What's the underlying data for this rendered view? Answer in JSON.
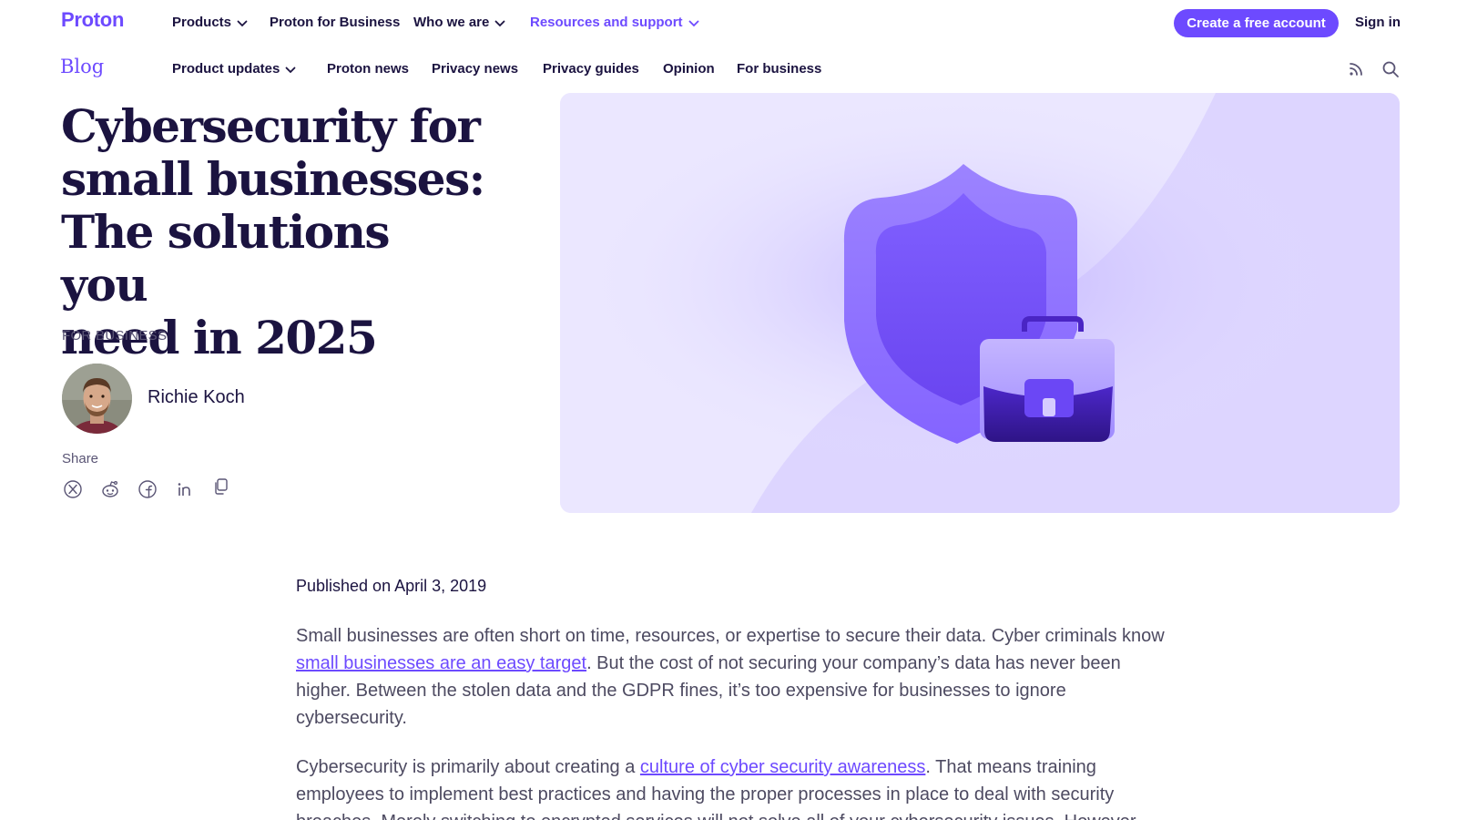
{
  "topnav": {
    "logo": "Proton",
    "items": [
      {
        "label": "Products",
        "dropdown": true
      },
      {
        "label": "Proton for Business",
        "dropdown": false
      },
      {
        "label": "Who we are",
        "dropdown": true
      },
      {
        "label": "Resources and support",
        "dropdown": true,
        "active": true
      }
    ],
    "cta_label": "Create a free account",
    "signin_label": "Sign in"
  },
  "blognav": {
    "logo": "Blog",
    "items": [
      {
        "label": "Product updates",
        "dropdown": true
      },
      {
        "label": "Proton news"
      },
      {
        "label": "Privacy news"
      },
      {
        "label": "Privacy guides"
      },
      {
        "label": "Opinion"
      },
      {
        "label": "For business"
      }
    ],
    "icons": [
      "rss-icon",
      "search-icon"
    ]
  },
  "article": {
    "title_lines": [
      "Cybersecurity for",
      "small businesses:",
      "The solutions you",
      "need in 2025"
    ],
    "category": "FOR BUSINESS",
    "author": "Richie Koch",
    "share_label": "Share",
    "share_icons": [
      "x-icon",
      "reddit-icon",
      "facebook-icon",
      "linkedin-icon",
      "copy-link-icon"
    ],
    "published": "Published on April 3, 2019",
    "p1_before": "Small businesses are often short on time, resources, or expertise to secure their data. Cyber criminals know ",
    "p1_link": "small businesses are an easy target",
    "p1_after": ". But the cost of not securing your company’s data has never been higher. Between the stolen data and the GDPR fines, it’s too expensive for businesses to ignore cybersecurity.",
    "p2_before": "Cybersecurity is primarily about creating a ",
    "p2_link": "culture of cyber security awareness",
    "p2_after": ". That means training employees to implement best practices and having the proper processes in place to deal with security breaches. Merely switching to encrypted services will not solve all of your cybersecurity issues. However,"
  },
  "colors": {
    "brand": "#6d4aff",
    "text": "#1b1340",
    "muted": "#5a5575",
    "hero_bg": "#e9e5ff"
  }
}
